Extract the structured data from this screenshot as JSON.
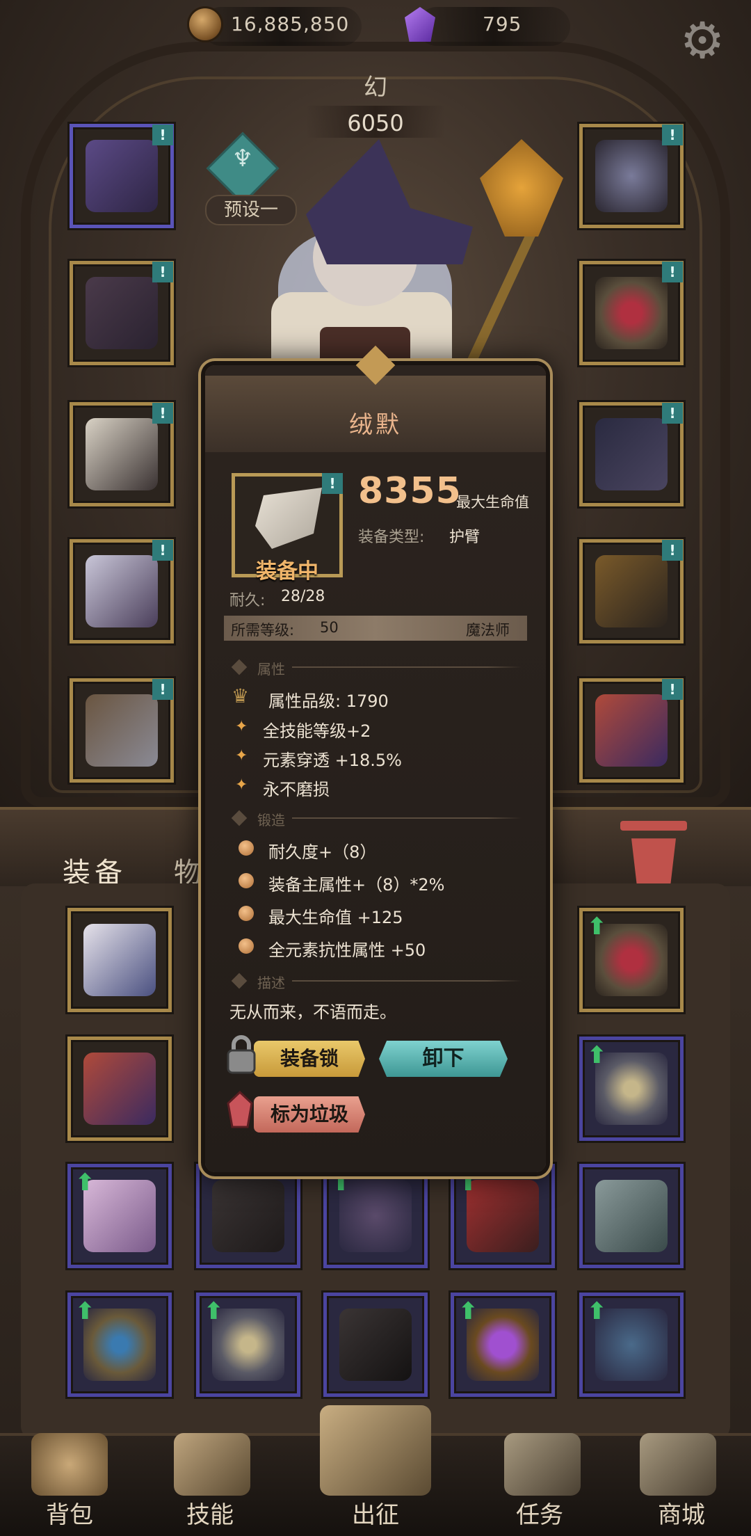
{
  "currency": {
    "gold_icon": "coin-icon",
    "gold": "16,885,850",
    "gem_icon": "purple-gem-icon",
    "gems": "795"
  },
  "header": {
    "settings_icon": "gear-icon",
    "class_name": "幻",
    "power": "6050",
    "preset_label": "预设一"
  },
  "tabs": {
    "equipment": "装备",
    "items": "物品"
  },
  "popup": {
    "title": "绒默",
    "equipped_label": "装备中",
    "stat_value": "8355",
    "stat_name": "最大生命值",
    "equip_type_label": "装备类型:",
    "equip_type_value": "护臂",
    "durability_label": "耐久:",
    "durability_value": "28/28",
    "required_level_label": "所需等级:",
    "required_level_value": "50",
    "required_class": "魔法师",
    "section_attributes": "属性",
    "attribute_grade": "属性品级: 1790",
    "attributes": [
      "全技能等级+2",
      "元素穿透 +18.5%",
      "永不磨损"
    ],
    "section_forge": "锻造",
    "forge": [
      "耐久度+（8）",
      "装备主属性+（8）*2%",
      "最大生命值 +125",
      "全元素抗性属性 +50"
    ],
    "section_desc": "描述",
    "description": "无从而来，不语而走。",
    "btn_lock": "装备锁",
    "btn_unequip": "卸下",
    "btn_junk": "标为垃圾"
  },
  "nav": {
    "items": [
      "背包",
      "技能",
      "出征",
      "任务",
      "商城"
    ]
  },
  "colors": {
    "accent_gold": "#f2c08c",
    "teal": "#3e9794",
    "slot_gold": "#b99a56",
    "slot_purple": "#4b45a0",
    "upgrade_green": "#3fc06a"
  }
}
